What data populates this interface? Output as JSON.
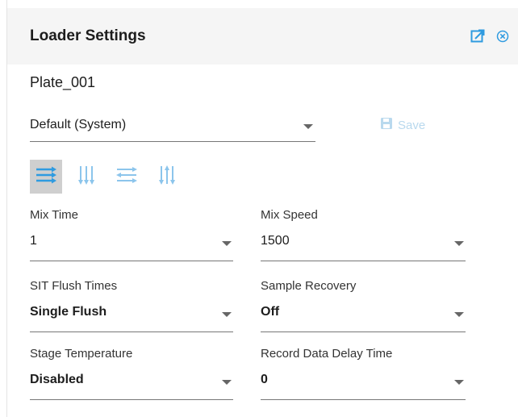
{
  "header": {
    "title": "Loader Settings",
    "popout_icon": "external-link-icon",
    "close_icon": "close-circle-icon",
    "accent_color": "#2f9be0"
  },
  "plate_name": "Plate_001",
  "profile": {
    "selected": "Default (System)",
    "save_label": "Save",
    "save_color": "#b9d9ee"
  },
  "modes": [
    {
      "name": "mode-rows-right",
      "icon": "rows-right-arrows-icon",
      "active": true
    },
    {
      "name": "mode-columns-down",
      "icon": "columns-down-arrows-icon",
      "active": false
    },
    {
      "name": "mode-rows-alternate",
      "icon": "rows-alternate-arrows-icon",
      "active": false
    },
    {
      "name": "mode-columns-alternate",
      "icon": "columns-alternate-arrows-icon",
      "active": false
    }
  ],
  "fields": {
    "mix_time": {
      "label": "Mix Time",
      "value": "1"
    },
    "mix_speed": {
      "label": "Mix Speed",
      "value": "1500"
    },
    "sit_flush_times": {
      "label": "SIT Flush Times",
      "value": "Single Flush"
    },
    "sample_recovery": {
      "label": "Sample Recovery",
      "value": "Off"
    },
    "stage_temperature": {
      "label": "Stage Temperature",
      "value": "Disabled"
    },
    "record_data_delay_time": {
      "label": "Record Data Delay Time",
      "value": "0"
    }
  }
}
